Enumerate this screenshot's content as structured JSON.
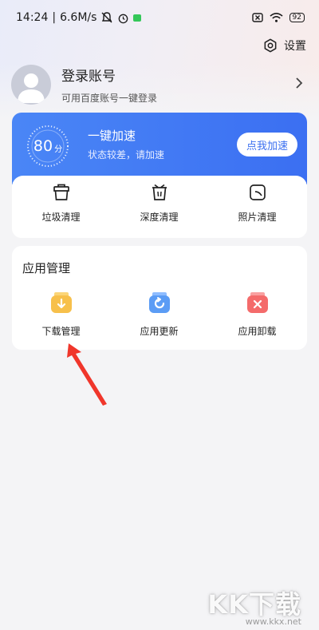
{
  "status_bar": {
    "time": "14:24",
    "separator": "|",
    "speed": "6.6M/s",
    "battery": "92"
  },
  "header": {
    "settings_label": "设置"
  },
  "profile": {
    "title": "登录账号",
    "subtitle": "可用百度账号一键登录"
  },
  "boost": {
    "score": "80",
    "score_unit": "分",
    "title": "一键加速",
    "subtitle": "状态较差，请加速",
    "button_label": "点我加速",
    "accent_color": "#3b6ff2"
  },
  "cleanup_tools": [
    {
      "label": "垃圾清理",
      "icon": "trash-bin-icon"
    },
    {
      "label": "深度清理",
      "icon": "deep-clean-icon"
    },
    {
      "label": "照片清理",
      "icon": "photo-icon"
    }
  ],
  "app_management": {
    "title": "应用管理",
    "items": [
      {
        "label": "下载管理",
        "icon": "download-manager-icon",
        "color": "#f7c04b"
      },
      {
        "label": "应用更新",
        "icon": "app-update-icon",
        "color": "#5b9cf5"
      },
      {
        "label": "应用卸载",
        "icon": "app-uninstall-icon",
        "color": "#f46b6b"
      }
    ]
  },
  "annotation": {
    "arrow_color": "#f0362b"
  },
  "watermark": {
    "text": "KK下载",
    "url": "www.kkx.net"
  }
}
